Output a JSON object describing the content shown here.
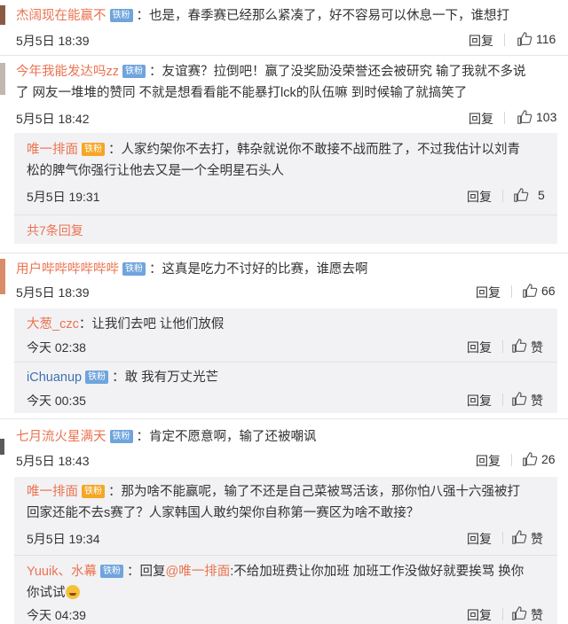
{
  "comments": [
    {
      "user": "杰阔现在能赢不",
      "badge": "铁粉",
      "sep": "：",
      "text": [
        "也是，春季赛已经那么紧凑了，好不容易可以休息一下，谁想打"
      ],
      "time": "5月5日 18:39",
      "reply_label": "回复",
      "likes": "116"
    },
    {
      "user": "今年我能发达吗zz",
      "badge": "铁粉",
      "sep": "：",
      "text": [
        "友谊赛？拉倒吧！赢了没奖励没荣誉还会被研究 输了我就不多说",
        "了 网友一堆堆的赞同 不就是想看看能不能暴打lck的队伍嘛 到时候输了就搞笑了"
      ],
      "time": "5月5日 18:42",
      "reply_label": "回复",
      "likes": "103",
      "replies": [
        {
          "user": "唯一排面",
          "badge": "铁粉",
          "sep": "：",
          "text": [
            "人家约架你不去打，韩杂就说你不敢接不战而胜了，不过我估计以刘青",
            "松的脾气你强行让他去又是一个全明星石头人"
          ],
          "time": "5月5日 19:31",
          "reply_label": "回复",
          "likes": "5"
        }
      ],
      "more": "共7条回复"
    },
    {
      "user": "用户哔哔哔哔哔哔",
      "badge": "铁粉",
      "sep": "：",
      "text": [
        "这真是吃力不讨好的比赛，谁愿去啊"
      ],
      "time": "5月5日 18:39",
      "reply_label": "回复",
      "likes": "66",
      "replies": [
        {
          "user": "大葱_czc",
          "sep": "：",
          "text": [
            "让我们去吧 让他们放假"
          ],
          "time": "今天 02:38",
          "reply_label": "回复",
          "likes": "赞"
        },
        {
          "user": "iChuanup",
          "badge": "铁粉",
          "sep": "：",
          "text": [
            "敢 我有万丈光芒"
          ],
          "time": "今天 00:35",
          "reply_label": "回复",
          "likes": "赞"
        }
      ]
    },
    {
      "user": "七月流火星满天",
      "badge": "铁粉",
      "sep": "：",
      "text": [
        "肯定不愿意啊，输了还被嘲讽"
      ],
      "time": "5月5日 18:43",
      "reply_label": "回复",
      "likes": "26",
      "replies": [
        {
          "user": "唯一排面",
          "badge": "铁粉",
          "sep": "：",
          "text": [
            "那为啥不能赢呢，输了不还是自己菜被骂活该，那你怕八强十六强被打",
            "回家还能不去s赛了？人家韩国人敢约架你自称第一赛区为啥不敢接？"
          ],
          "time": "5月5日 19:34",
          "reply_label": "回复",
          "likes": "赞"
        },
        {
          "user": "Yuuik、水幕",
          "badge": "铁粉",
          "sep": "：",
          "text_prefix": "回复",
          "mention": "@唯一排面",
          "text_after": ":不给加班费让你加班 加班工作没做好就要挨骂 换你",
          "text2": "你试试",
          "time": "今天 04:39",
          "reply_label": "回复",
          "likes": "赞"
        }
      ]
    }
  ]
}
